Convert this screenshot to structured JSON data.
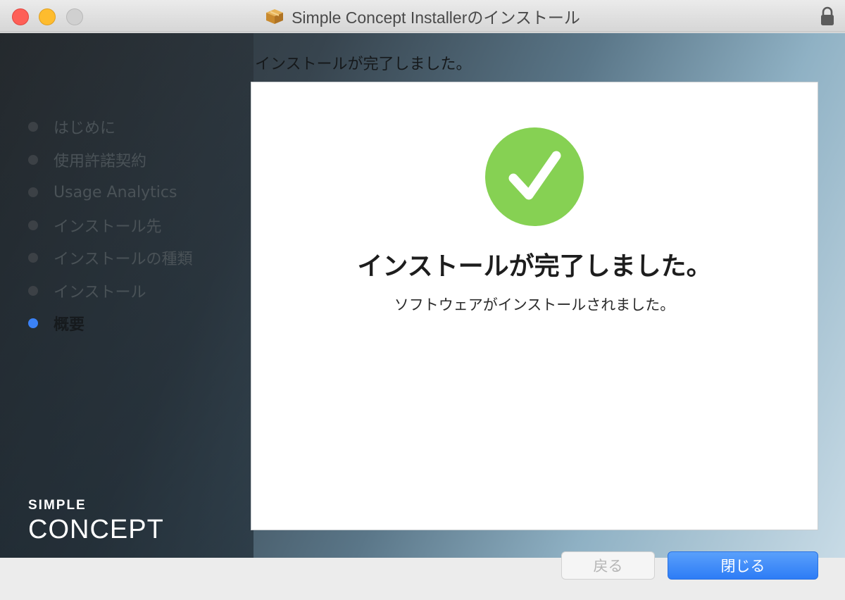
{
  "window": {
    "title": "Simple Concept Installerのインストール"
  },
  "page": {
    "heading": "インストールが完了しました。"
  },
  "sidebar": {
    "steps": [
      {
        "label": "はじめに",
        "active": false
      },
      {
        "label": "使用許諾契約",
        "active": false
      },
      {
        "label": "Usage Analytics",
        "active": false
      },
      {
        "label": "インストール先",
        "active": false
      },
      {
        "label": "インストールの種類",
        "active": false
      },
      {
        "label": "インストール",
        "active": false
      },
      {
        "label": "概要",
        "active": true
      }
    ]
  },
  "panel": {
    "main_message": "インストールが完了しました。",
    "sub_message": "ソフトウェアがインストールされました。"
  },
  "brand": {
    "line1": "SIMPLE",
    "line2": "CONCEPT"
  },
  "buttons": {
    "back_label": "戻る",
    "close_label": "閉じる"
  },
  "colors": {
    "check_green": "#86d153",
    "active_dot": "#3b82f6",
    "primary_button": "#2d7cf6"
  },
  "icons": {
    "title_icon": "package-icon",
    "lock_icon": "lock-icon",
    "success_icon": "checkmark-circle-icon"
  }
}
